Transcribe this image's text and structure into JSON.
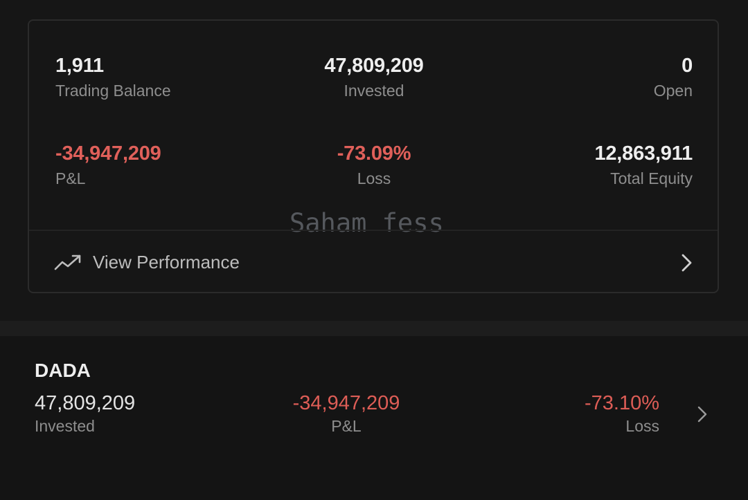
{
  "summary": {
    "trading_balance": {
      "value": "1,911",
      "label": "Trading Balance"
    },
    "invested": {
      "value": "47,809,209",
      "label": "Invested"
    },
    "open": {
      "value": "0",
      "label": "Open"
    },
    "pnl": {
      "value": "-34,947,209",
      "label": "P&L"
    },
    "loss": {
      "value": "-73.09%",
      "label": "Loss"
    },
    "total_equity": {
      "value": "12,863,911",
      "label": "Total Equity"
    },
    "watermark": "Saham fess",
    "view_performance": {
      "label": "View Performance",
      "icon": "trend-up-icon"
    }
  },
  "holdings": [
    {
      "ticker": "DADA",
      "invested": {
        "value": "47,809,209",
        "label": "Invested"
      },
      "pnl": {
        "value": "-34,947,209",
        "label": "P&L"
      },
      "loss": {
        "value": "-73.10%",
        "label": "Loss"
      }
    }
  ],
  "colors": {
    "background": "#161616",
    "negative": "#e0605a",
    "text_primary": "#eeeeee",
    "text_secondary": "#8e8e8e",
    "border": "#2b2b2b"
  }
}
